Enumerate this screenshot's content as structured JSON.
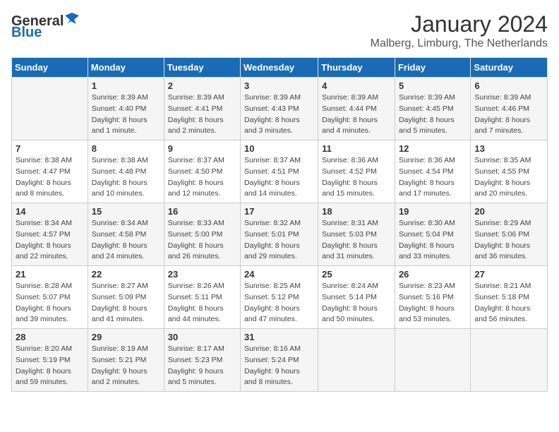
{
  "header": {
    "logo_general": "General",
    "logo_blue": "Blue",
    "month_year": "January 2024",
    "location": "Malberg, Limburg, The Netherlands"
  },
  "calendar": {
    "days_of_week": [
      "Sunday",
      "Monday",
      "Tuesday",
      "Wednesday",
      "Thursday",
      "Friday",
      "Saturday"
    ],
    "weeks": [
      [
        {
          "day": "",
          "info": ""
        },
        {
          "day": "1",
          "info": "Sunrise: 8:39 AM\nSunset: 4:40 PM\nDaylight: 8 hours\nand 1 minute."
        },
        {
          "day": "2",
          "info": "Sunrise: 8:39 AM\nSunset: 4:41 PM\nDaylight: 8 hours\nand 2 minutes."
        },
        {
          "day": "3",
          "info": "Sunrise: 8:39 AM\nSunset: 4:43 PM\nDaylight: 8 hours\nand 3 minutes."
        },
        {
          "day": "4",
          "info": "Sunrise: 8:39 AM\nSunset: 4:44 PM\nDaylight: 8 hours\nand 4 minutes."
        },
        {
          "day": "5",
          "info": "Sunrise: 8:39 AM\nSunset: 4:45 PM\nDaylight: 8 hours\nand 5 minutes."
        },
        {
          "day": "6",
          "info": "Sunrise: 8:39 AM\nSunset: 4:46 PM\nDaylight: 8 hours\nand 7 minutes."
        }
      ],
      [
        {
          "day": "7",
          "info": "Sunrise: 8:38 AM\nSunset: 4:47 PM\nDaylight: 8 hours\nand 8 minutes."
        },
        {
          "day": "8",
          "info": "Sunrise: 8:38 AM\nSunset: 4:48 PM\nDaylight: 8 hours\nand 10 minutes."
        },
        {
          "day": "9",
          "info": "Sunrise: 8:37 AM\nSunset: 4:50 PM\nDaylight: 8 hours\nand 12 minutes."
        },
        {
          "day": "10",
          "info": "Sunrise: 8:37 AM\nSunset: 4:51 PM\nDaylight: 8 hours\nand 14 minutes."
        },
        {
          "day": "11",
          "info": "Sunrise: 8:36 AM\nSunset: 4:52 PM\nDaylight: 8 hours\nand 15 minutes."
        },
        {
          "day": "12",
          "info": "Sunrise: 8:36 AM\nSunset: 4:54 PM\nDaylight: 8 hours\nand 17 minutes."
        },
        {
          "day": "13",
          "info": "Sunrise: 8:35 AM\nSunset: 4:55 PM\nDaylight: 8 hours\nand 20 minutes."
        }
      ],
      [
        {
          "day": "14",
          "info": "Sunrise: 8:34 AM\nSunset: 4:57 PM\nDaylight: 8 hours\nand 22 minutes."
        },
        {
          "day": "15",
          "info": "Sunrise: 8:34 AM\nSunset: 4:58 PM\nDaylight: 8 hours\nand 24 minutes."
        },
        {
          "day": "16",
          "info": "Sunrise: 8:33 AM\nSunset: 5:00 PM\nDaylight: 8 hours\nand 26 minutes."
        },
        {
          "day": "17",
          "info": "Sunrise: 8:32 AM\nSunset: 5:01 PM\nDaylight: 8 hours\nand 29 minutes."
        },
        {
          "day": "18",
          "info": "Sunrise: 8:31 AM\nSunset: 5:03 PM\nDaylight: 8 hours\nand 31 minutes."
        },
        {
          "day": "19",
          "info": "Sunrise: 8:30 AM\nSunset: 5:04 PM\nDaylight: 8 hours\nand 33 minutes."
        },
        {
          "day": "20",
          "info": "Sunrise: 8:29 AM\nSunset: 5:06 PM\nDaylight: 8 hours\nand 36 minutes."
        }
      ],
      [
        {
          "day": "21",
          "info": "Sunrise: 8:28 AM\nSunset: 5:07 PM\nDaylight: 8 hours\nand 39 minutes."
        },
        {
          "day": "22",
          "info": "Sunrise: 8:27 AM\nSunset: 5:09 PM\nDaylight: 8 hours\nand 41 minutes."
        },
        {
          "day": "23",
          "info": "Sunrise: 8:26 AM\nSunset: 5:11 PM\nDaylight: 8 hours\nand 44 minutes."
        },
        {
          "day": "24",
          "info": "Sunrise: 8:25 AM\nSunset: 5:12 PM\nDaylight: 8 hours\nand 47 minutes."
        },
        {
          "day": "25",
          "info": "Sunrise: 8:24 AM\nSunset: 5:14 PM\nDaylight: 8 hours\nand 50 minutes."
        },
        {
          "day": "26",
          "info": "Sunrise: 8:23 AM\nSunset: 5:16 PM\nDaylight: 8 hours\nand 53 minutes."
        },
        {
          "day": "27",
          "info": "Sunrise: 8:21 AM\nSunset: 5:18 PM\nDaylight: 8 hours\nand 56 minutes."
        }
      ],
      [
        {
          "day": "28",
          "info": "Sunrise: 8:20 AM\nSunset: 5:19 PM\nDaylight: 8 hours\nand 59 minutes."
        },
        {
          "day": "29",
          "info": "Sunrise: 8:19 AM\nSunset: 5:21 PM\nDaylight: 9 hours\nand 2 minutes."
        },
        {
          "day": "30",
          "info": "Sunrise: 8:17 AM\nSunset: 5:23 PM\nDaylight: 9 hours\nand 5 minutes."
        },
        {
          "day": "31",
          "info": "Sunrise: 8:16 AM\nSunset: 5:24 PM\nDaylight: 9 hours\nand 8 minutes."
        },
        {
          "day": "",
          "info": ""
        },
        {
          "day": "",
          "info": ""
        },
        {
          "day": "",
          "info": ""
        }
      ]
    ]
  }
}
